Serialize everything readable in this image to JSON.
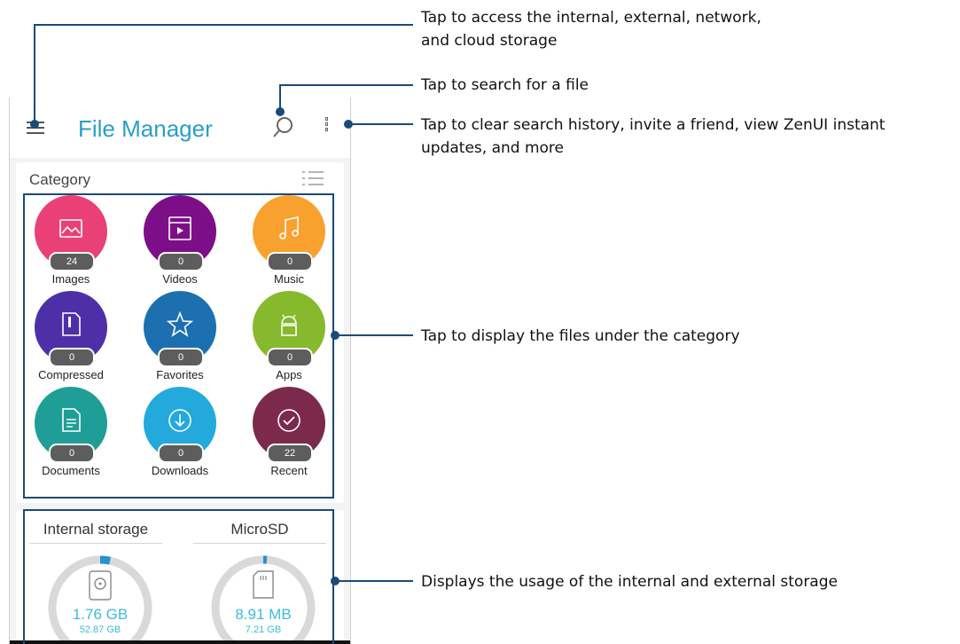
{
  "app": {
    "title": "File Manager"
  },
  "category": {
    "title": "Category",
    "items": [
      {
        "label": "Images",
        "count": "24",
        "color": "#e94176",
        "icon": "image-icon"
      },
      {
        "label": "Videos",
        "count": "0",
        "color": "#7c0f87",
        "icon": "video-icon"
      },
      {
        "label": "Music",
        "count": "0",
        "color": "#f9a12f",
        "icon": "music-icon"
      },
      {
        "label": "Compressed",
        "count": "0",
        "color": "#4e2fa8",
        "icon": "zip-file-icon"
      },
      {
        "label": "Favorites",
        "count": "0",
        "color": "#1d70b0",
        "icon": "star-icon"
      },
      {
        "label": "Apps",
        "count": "0",
        "color": "#86b92b",
        "icon": "android-icon"
      },
      {
        "label": "Documents",
        "count": "0",
        "color": "#1e9e96",
        "icon": "document-icon"
      },
      {
        "label": "Downloads",
        "count": "0",
        "color": "#23a9dc",
        "icon": "download-icon"
      },
      {
        "label": "Recent",
        "count": "22",
        "color": "#7c2a4c",
        "icon": "check-icon"
      }
    ]
  },
  "storage": {
    "internal": {
      "label": "Internal storage",
      "used": "1.76 GB",
      "total": "52.87 GB",
      "used_fraction": 0.033
    },
    "microsd": {
      "label": "MicroSD",
      "used": "8.91 MB",
      "total": "7.21 GB",
      "used_fraction": 0.012
    }
  },
  "callouts": {
    "menu": "Tap to access the internal, external, network,\nand cloud storage",
    "search": "Tap to search for a file",
    "more": "Tap to clear search history, invite a friend, view ZenUI instant\nupdates, and more",
    "category": "Tap to display the files under the category",
    "storage": "Displays the usage of the internal and external storage"
  },
  "colors": {
    "accent": "#2a9dc9",
    "annotation_line": "#1a4a78",
    "gauge_track": "#d9d9d9",
    "gauge_used": "#2a8fd0"
  }
}
